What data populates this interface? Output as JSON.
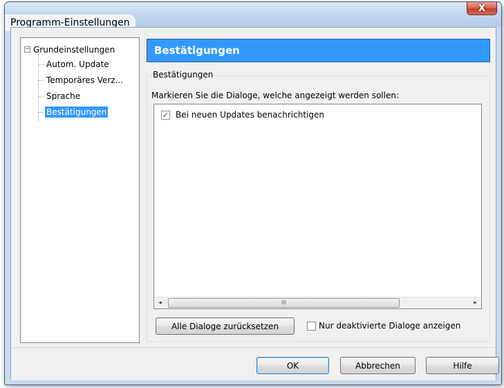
{
  "window": {
    "title": "Programm-Einstellungen",
    "close_label": "X"
  },
  "tree": {
    "root": {
      "expander": "−",
      "label": "Grundeinstellungen"
    },
    "children": [
      {
        "label": "Autom. Update"
      },
      {
        "label": "Temporäres Verz..."
      },
      {
        "label": "Sprache"
      },
      {
        "label": "Bestätigungen",
        "selected": true
      }
    ]
  },
  "panel": {
    "header": "Bestätigungen",
    "group_label": "Bestätigungen",
    "instruction": "Markieren Sie die Dialoge, welche angezeigt werden sollen:",
    "list_items": [
      {
        "label": "Bei neuen Updates benachrichtigen",
        "checked": true,
        "check_glyph": "✓"
      }
    ],
    "scrollbar": {
      "left_arrow": "◂",
      "right_arrow": "▸",
      "thumb_grip": "III"
    },
    "reset_button": "Alle Dialoge zurücksetzen",
    "only_disabled_checkbox": {
      "label": "Nur deaktivierte Dialoge anzeigen",
      "checked": false
    }
  },
  "buttons": {
    "ok": "OK",
    "cancel": "Abbrechen",
    "help": "Hilfe"
  },
  "colors": {
    "selection": "#3399ff",
    "header_bar": "#3399ff",
    "close_button": "#c2432e"
  }
}
